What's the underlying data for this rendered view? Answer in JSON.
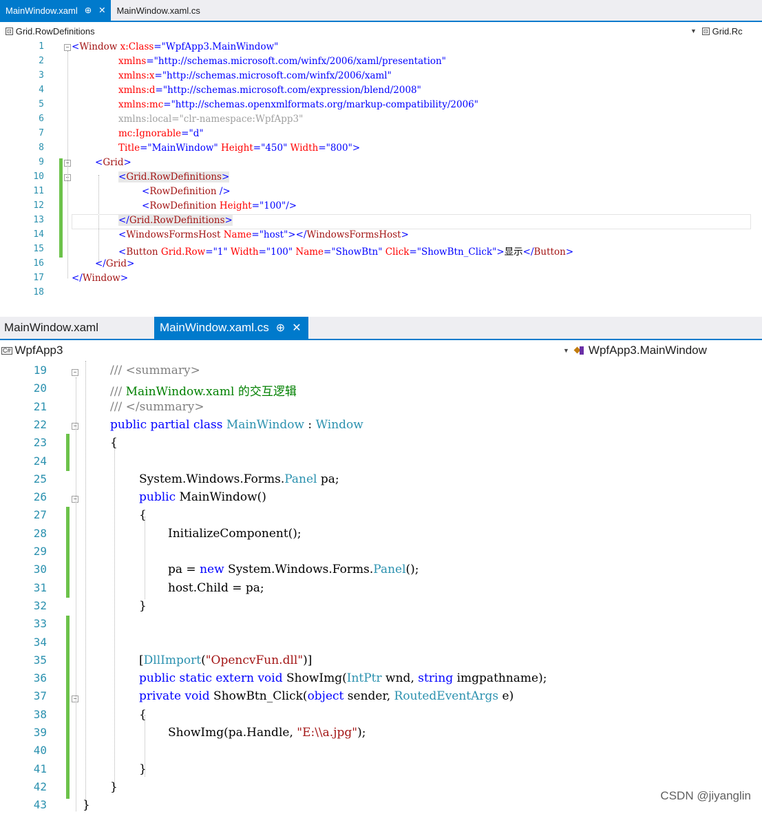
{
  "editor1": {
    "tabs": [
      {
        "label": "MainWindow.xaml",
        "active": true,
        "pin": "⊕",
        "close": "✕"
      },
      {
        "label": "MainWindow.xaml.cs",
        "active": false
      }
    ],
    "nav_left": "Grid.RowDefinitions",
    "nav_right": "Grid.Rc",
    "nav_icon": "grid-icon",
    "lines": [
      {
        "n": "1",
        "text": "<Window x:Class=\"WpfApp3.MainWindow\""
      },
      {
        "n": "2",
        "text": "xmlns=\"http://schemas.microsoft.com/winfx/2006/xaml/presentation\""
      },
      {
        "n": "3",
        "text": "xmlns:x=\"http://schemas.microsoft.com/winfx/2006/xaml\""
      },
      {
        "n": "4",
        "text": "xmlns:d=\"http://schemas.microsoft.com/expression/blend/2008\""
      },
      {
        "n": "5",
        "text": "xmlns:mc=\"http://schemas.openxmlformats.org/markup-compatibility/2006\""
      },
      {
        "n": "6",
        "text": "xmlns:local=\"clr-namespace:WpfApp3\""
      },
      {
        "n": "7",
        "text": "mc:Ignorable=\"d\""
      },
      {
        "n": "8",
        "text": "Title=\"MainWindow\" Height=\"450\" Width=\"800\">"
      },
      {
        "n": "9",
        "text": "<Grid>"
      },
      {
        "n": "10",
        "text": "<Grid.RowDefinitions>"
      },
      {
        "n": "11",
        "text": "<RowDefinition />"
      },
      {
        "n": "12",
        "text": "<RowDefinition Height=\"100\"/>"
      },
      {
        "n": "13",
        "text": "</Grid.RowDefinitions>"
      },
      {
        "n": "14",
        "text": "<WindowsFormsHost Name=\"host\"></WindowsFormsHost>"
      },
      {
        "n": "15",
        "text": "<Button Grid.Row=\"1\" Width=\"100\" Name=\"ShowBtn\" Click=\"ShowBtn_Click\">显示</Button>"
      },
      {
        "n": "16",
        "text": "</Grid>"
      },
      {
        "n": "17",
        "text": "</Window>"
      },
      {
        "n": "18",
        "text": ""
      }
    ]
  },
  "editor2": {
    "tabs": [
      {
        "label": "MainWindow.xaml",
        "active": false
      },
      {
        "label": "MainWindow.xaml.cs",
        "active": true,
        "pin": "⊕",
        "close": "✕"
      }
    ],
    "nav_left": "WpfApp3",
    "nav_right": "WpfApp3.MainWindow",
    "nav_icon": "csharp-project-icon",
    "lines": [
      {
        "n": "19",
        "text": "/// <summary>"
      },
      {
        "n": "20",
        "text": "/// MainWindow.xaml 的交互逻辑"
      },
      {
        "n": "21",
        "text": "/// </summary>"
      },
      {
        "n": "22",
        "text": "public partial class MainWindow : Window"
      },
      {
        "n": "23",
        "text": "{"
      },
      {
        "n": "24",
        "text": ""
      },
      {
        "n": "25",
        "text": "System.Windows.Forms.Panel pa;"
      },
      {
        "n": "26",
        "text": "public MainWindow()"
      },
      {
        "n": "27",
        "text": "{"
      },
      {
        "n": "28",
        "text": "InitializeComponent();"
      },
      {
        "n": "29",
        "text": ""
      },
      {
        "n": "30",
        "text": "pa = new System.Windows.Forms.Panel();"
      },
      {
        "n": "31",
        "text": "host.Child = pa;"
      },
      {
        "n": "32",
        "text": "}"
      },
      {
        "n": "33",
        "text": ""
      },
      {
        "n": "34",
        "text": ""
      },
      {
        "n": "35",
        "text": "[DllImport(\"OpencvFun.dll\")]"
      },
      {
        "n": "36",
        "text": "public static extern void ShowImg(IntPtr wnd, string imgpathname);"
      },
      {
        "n": "37",
        "text": "private void ShowBtn_Click(object sender, RoutedEventArgs e)"
      },
      {
        "n": "38",
        "text": "{"
      },
      {
        "n": "39",
        "text": "ShowImg(pa.Handle, \"E:\\\\a.jpg\");"
      },
      {
        "n": "40",
        "text": ""
      },
      {
        "n": "41",
        "text": "}"
      },
      {
        "n": "42",
        "text": "}"
      },
      {
        "n": "43",
        "text": "}"
      }
    ]
  },
  "watermark": "CSDN @jiyanglin",
  "colors": {
    "accent": "#007acc",
    "change_bar": "#6cc24a",
    "line_number": "#2b91af",
    "keyword": "#0000ff",
    "xml_tag": "#a31515",
    "xml_attr": "#ff0000",
    "comment": "#008000"
  }
}
